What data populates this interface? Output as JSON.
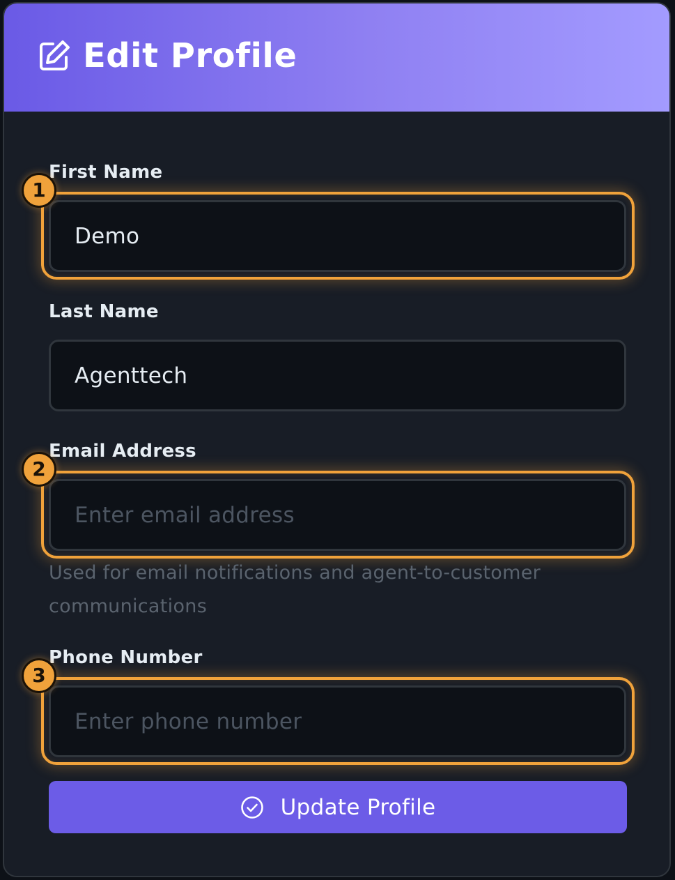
{
  "header": {
    "title": "Edit Profile",
    "icon": "edit-icon"
  },
  "form": {
    "first_name": {
      "label": "First Name",
      "value": "Demo",
      "placeholder": "",
      "badge": "1"
    },
    "last_name": {
      "label": "Last Name",
      "value": "Agenttech",
      "placeholder": ""
    },
    "email": {
      "label": "Email Address",
      "value": "",
      "placeholder": "Enter email address",
      "helper": "Used for email notifications and agent-to-customer communications",
      "badge": "2"
    },
    "phone": {
      "label": "Phone Number",
      "value": "",
      "placeholder": "Enter phone number",
      "badge": "3"
    },
    "submit": {
      "label": "Update Profile",
      "icon": "check-circle-icon"
    }
  },
  "colors": {
    "accent": "#6c5ce7",
    "highlight": "#f0a23b",
    "background": "#181d26",
    "input_background": "#0d1117"
  }
}
